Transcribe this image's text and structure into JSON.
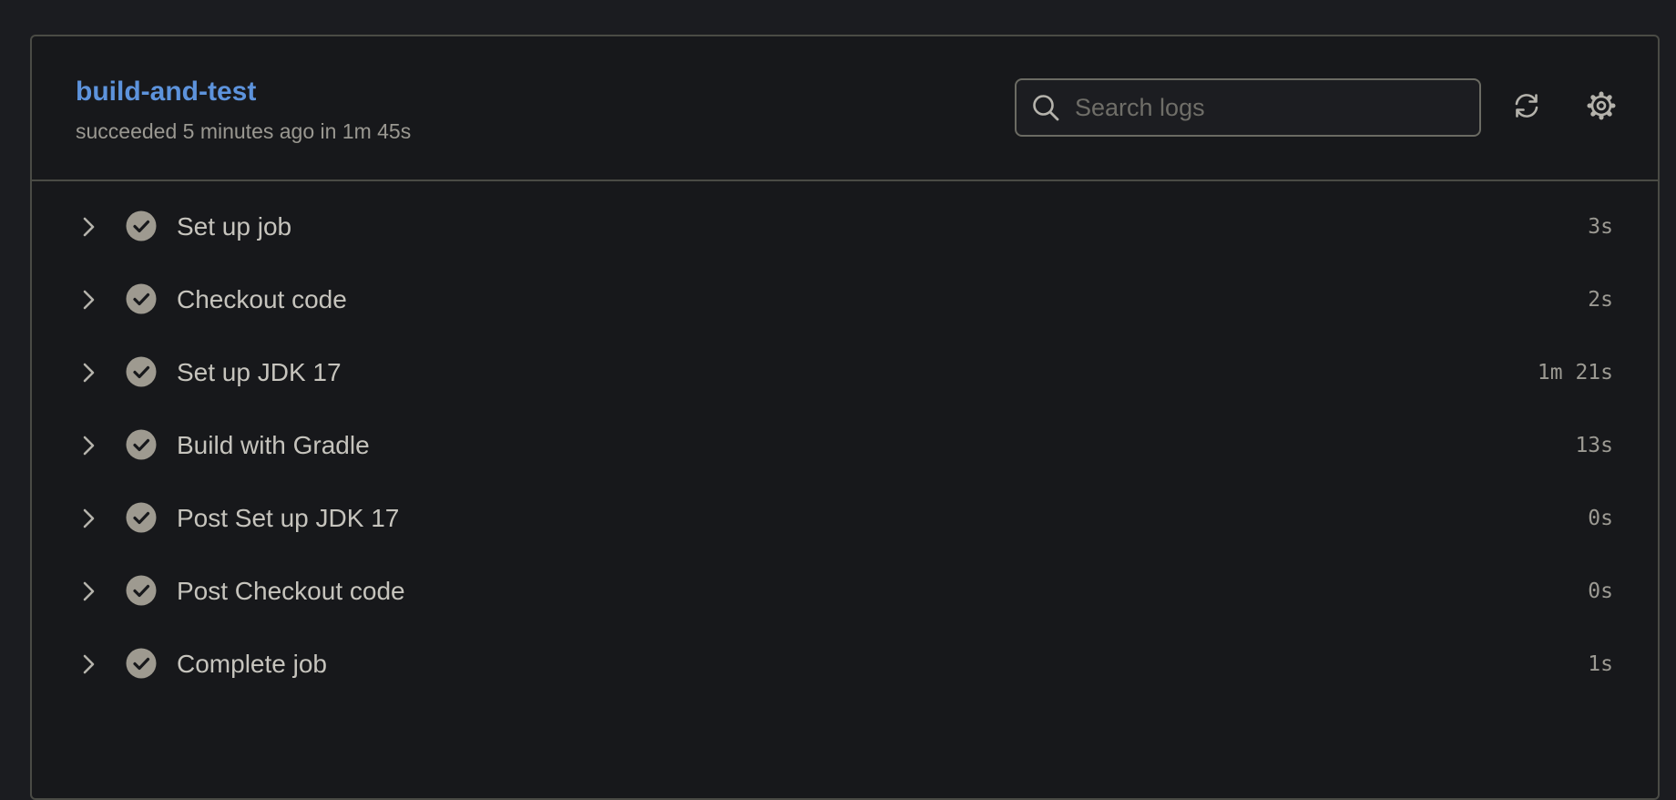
{
  "job": {
    "title": "build-and-test",
    "subtitle": "succeeded 5 minutes ago in 1m 45s",
    "status": "succeeded"
  },
  "search": {
    "placeholder": "Search logs",
    "value": "",
    "icon": "search-icon"
  },
  "toolbar": {
    "refresh_icon": "refresh-icon",
    "settings_icon": "gear-icon"
  },
  "steps": [
    {
      "name": "Set up job",
      "duration": "3s",
      "status": "success"
    },
    {
      "name": "Checkout code",
      "duration": "2s",
      "status": "success"
    },
    {
      "name": "Set up JDK 17",
      "duration": "1m 21s",
      "status": "success"
    },
    {
      "name": "Build with Gradle",
      "duration": "13s",
      "status": "success"
    },
    {
      "name": "Post Set up JDK 17",
      "duration": "0s",
      "status": "success"
    },
    {
      "name": "Post Checkout code",
      "duration": "0s",
      "status": "success"
    },
    {
      "name": "Complete job",
      "duration": "1s",
      "status": "success"
    }
  ],
  "colors": {
    "background": "#1b1c20",
    "panel": "#17181b",
    "border": "#4a4b45",
    "title_link": "#5d93dc",
    "success_icon": "#9e9a90",
    "text": "#c6c4bd",
    "muted_text": "#9a9891"
  }
}
